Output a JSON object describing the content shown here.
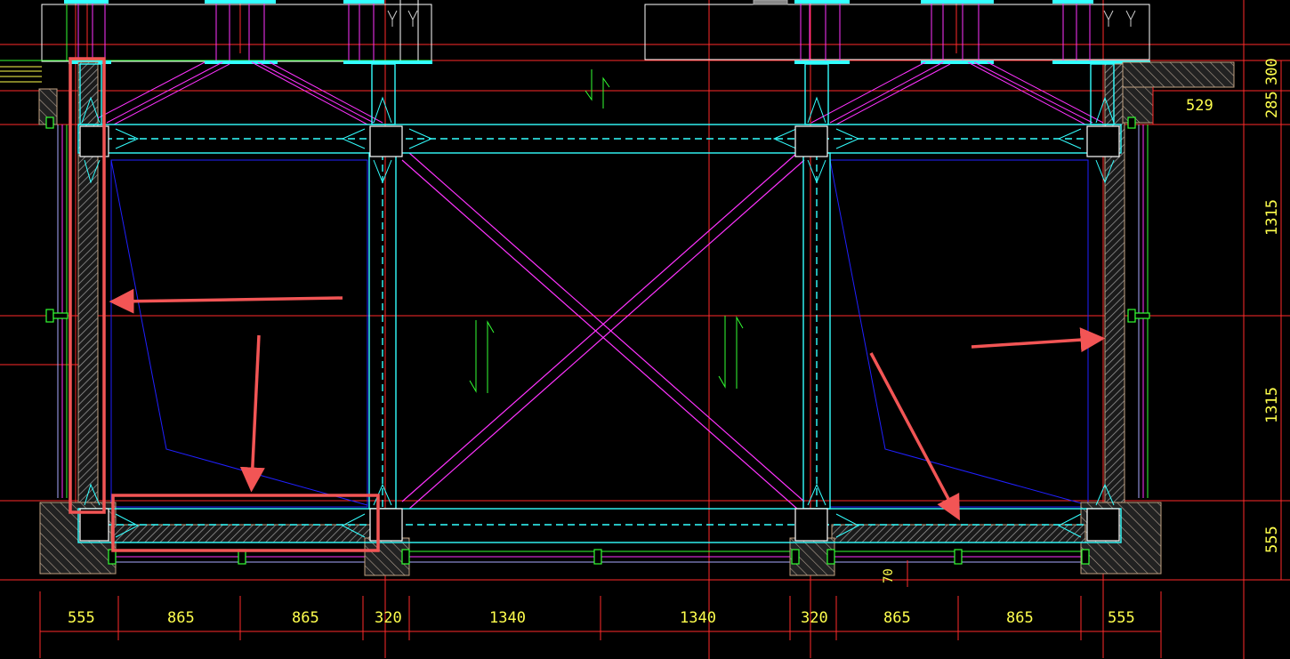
{
  "drawing": {
    "background": "#000000",
    "colors": {
      "red": "#ff2a2a",
      "cyan": "#33ffff",
      "magenta": "#ff33ff",
      "blue": "#2020ff",
      "green": "#33ff33",
      "yellow": "#ffff4d",
      "white": "#ffffff",
      "annotation": "#f25555",
      "hatch": "#8a8a8a"
    },
    "bottom_dimensions": [
      "555",
      "865",
      "865",
      "320",
      "1340",
      "1340",
      "320",
      "865",
      "865",
      "555"
    ],
    "right_dimensions": [
      "300",
      "285",
      "1315",
      "1315",
      "555"
    ],
    "top_right_dimension": "529",
    "small_dimension": "70"
  }
}
